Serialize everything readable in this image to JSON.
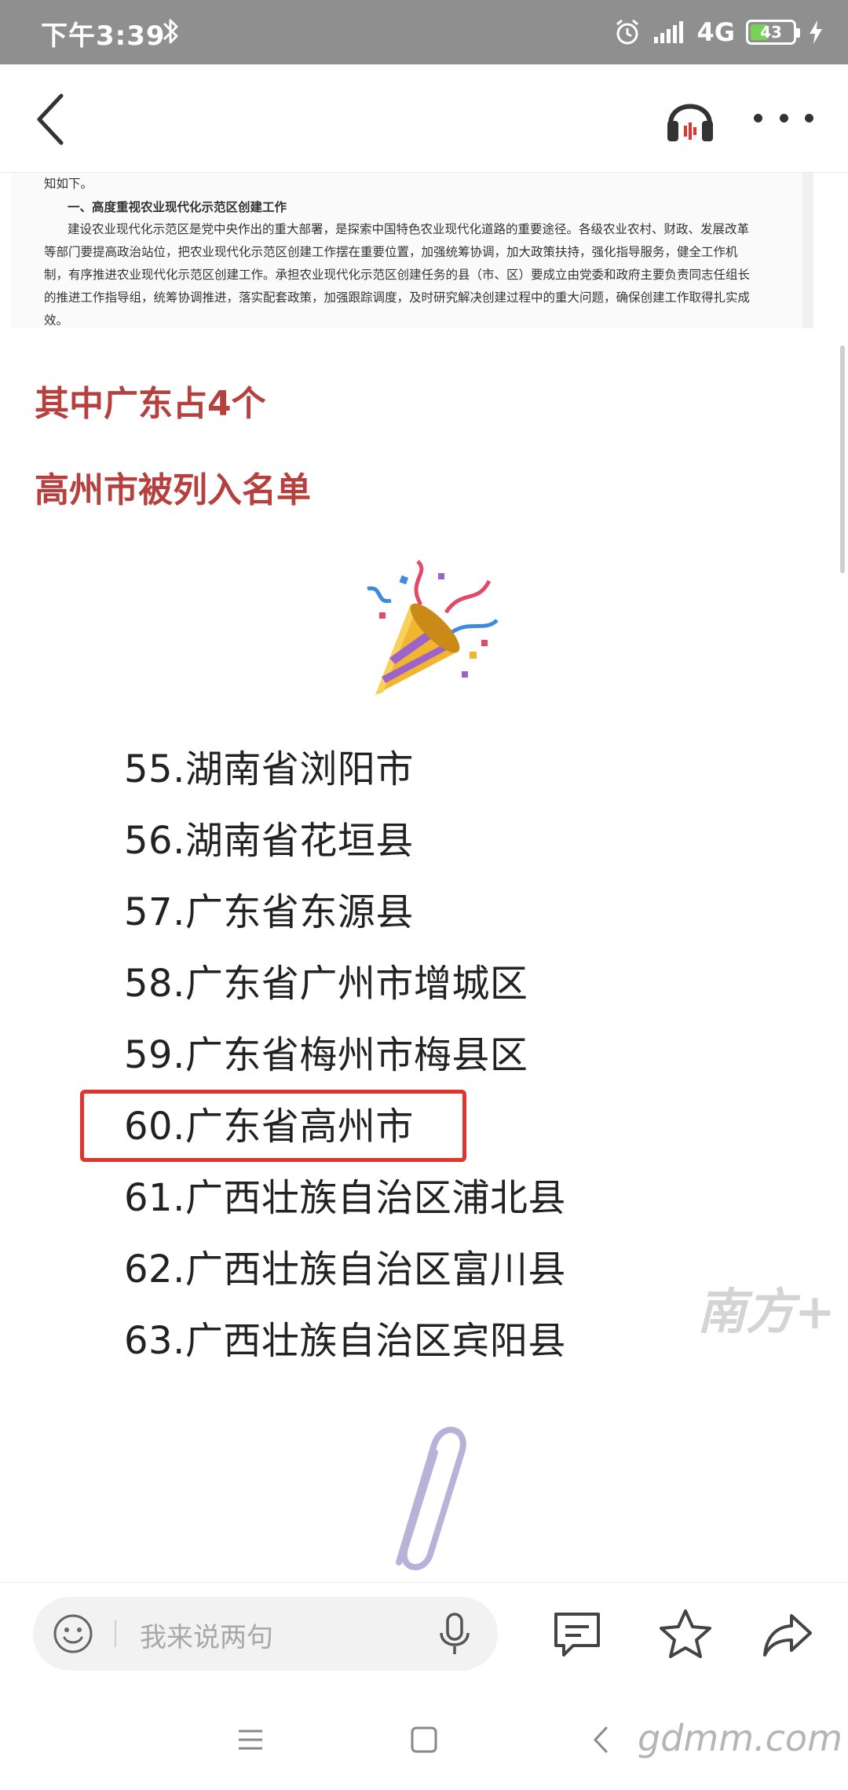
{
  "status_bar": {
    "time": "下午3:39",
    "network": "4G",
    "battery": "43",
    "battery_level": 0.43
  },
  "document_excerpt": {
    "lines": [
      "知如下。",
      "一、高度重视农业现代化示范区创建工作",
      "建设农业现代化示范区是党中央作出的重大部署，是探索中国特色农业现代化道路的重要途径。各级农业农村、财政、发展改革",
      "等部门要提高政治站位，把农业现代化示范区创建工作摆在重要位置，加强统筹协调，加大政策扶持，强化指导服务，健全工作机",
      "制，有序推进农业现代化示范区创建工作。承担农业现代化示范区创建任务的县（市、区）要成立由党委和政府主要负责同志任组长",
      "的推进工作指导组，统筹协调推进，落实配套政策，加强跟踪调度，及时研究解决创建过程中的重大问题，确保创建工作取得扎实成",
      "效。"
    ]
  },
  "article": {
    "red_text_1": "其中广东占4个",
    "red_text_2": "高州市被列入名单",
    "list": [
      "55.湖南省浏阳市",
      "56.湖南省花垣县",
      "57.广东省东源县",
      "58.广东省广州市增城区",
      "59.广东省梅州市梅县区",
      "60.广东省高州市",
      "61.广西壮族自治区浦北县",
      "62.广西壮族自治区富川县",
      "63.广西壮族自治区宾阳县"
    ],
    "watermark": "南方+"
  },
  "bottom_bar": {
    "comment_placeholder": "我来说两句"
  },
  "footer_mark": "gdmm.com",
  "colors": {
    "accent_red": "#b5403e",
    "highlight_border": "#e2332d",
    "status_bar_bg": "#8f8f8f"
  },
  "icons": [
    "bluetooth-icon",
    "alarm-icon",
    "signal-icon",
    "battery-icon",
    "charging-icon",
    "back-icon",
    "headphones-icon",
    "more-icon",
    "party-popper-icon",
    "paperclip-icon",
    "smile-icon",
    "mic-icon",
    "comment-icon",
    "star-icon",
    "share-icon",
    "menu-icon",
    "home-icon",
    "system-back-icon"
  ]
}
